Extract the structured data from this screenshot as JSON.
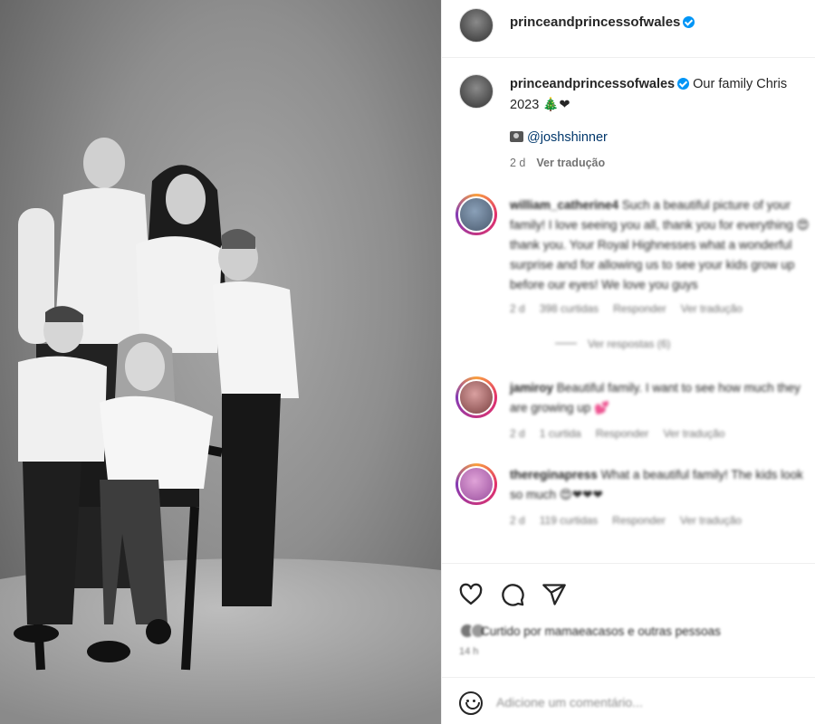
{
  "photo": {
    "alt_subject": "Black and white family portrait",
    "icon": "family-photo"
  },
  "post": {
    "username": "princeandprincessofwales",
    "verified": true
  },
  "caption": {
    "username": "princeandprincessofwales",
    "text_line1": "Our family Chris",
    "text_line2": "2023 🎄❤",
    "credit": "@joshshinner",
    "age": "2 d",
    "translate": "Ver tradução"
  },
  "comments": [
    {
      "username": "william_catherine4",
      "text": "Such a beautiful picture of your family! I love seeing you all, thank you for everything 😍 thank you. Your Royal Highnesses what a wonderful surprise and for allowing us to see your kids grow up before our eyes! We love you guys",
      "age": "2 d",
      "likes": "398 curtidas",
      "reply": "Responder",
      "translate": "Ver tradução"
    },
    {
      "username": "jamiroy",
      "text": "Beautiful family. I want to see how much they are growing up 💕",
      "age": "2 d",
      "likes": "1 curtida",
      "reply": "Responder",
      "translate": "Ver tradução"
    },
    {
      "username": "thereginapress",
      "text": "What a beautiful family! The kids look so much 😍❤❤❤",
      "age": "2 d",
      "likes": "119 curtidas",
      "reply": "Responder",
      "translate": "Ver tradução"
    }
  ],
  "replies": {
    "view_replies": "Ver respostas (6)"
  },
  "actions": {
    "like_icon": "heart-icon",
    "comment_icon": "comment-icon",
    "share_icon": "share-icon",
    "likes_text": "Curtido por mamaeacasos e outras pessoas",
    "age": "14 h"
  },
  "add_comment": {
    "placeholder": "Adicione um comentário..."
  },
  "colors": {
    "verified": "#0095f6",
    "link": "#00376b",
    "muted": "#737373",
    "border": "#efefef"
  }
}
